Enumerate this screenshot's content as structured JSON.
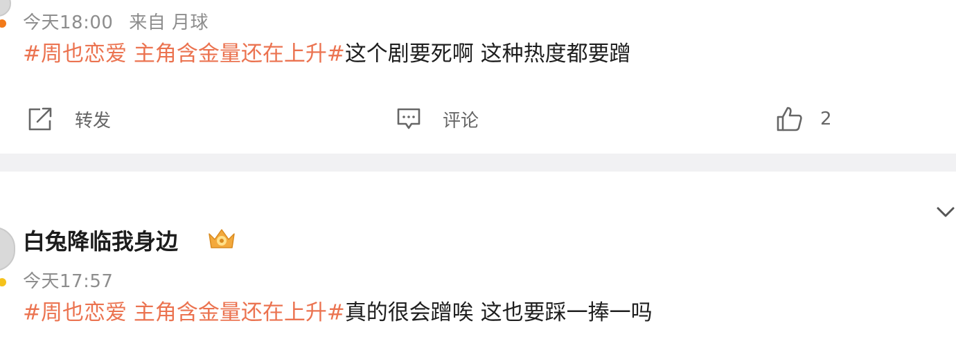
{
  "post1": {
    "meta_time": "今天18:00",
    "meta_source": "来自 月球",
    "topic": "#周也恋爱 主角含金量还在上升#",
    "body": "这个剧要死啊 这种热度都要蹭",
    "actions": {
      "repost_label": "转发",
      "comment_label": "评论",
      "like_count": "2"
    }
  },
  "post2": {
    "username": "白兔降临我身边",
    "meta_time": "今天17:57",
    "topic": "#周也恋爱 主角含金量还在上升#",
    "body": "真的很会蹭唉 这也要踩一捧一吗"
  },
  "icons": {
    "repost": "share-icon",
    "comment": "comment-icon",
    "like": "thumbs-up-icon",
    "badge": "vip-crown-badge-icon",
    "expand": "chevron-down-icon"
  },
  "colors": {
    "topic": "#eb7350",
    "meta": "#8d8d8d",
    "separator": "#f1f1f3"
  }
}
